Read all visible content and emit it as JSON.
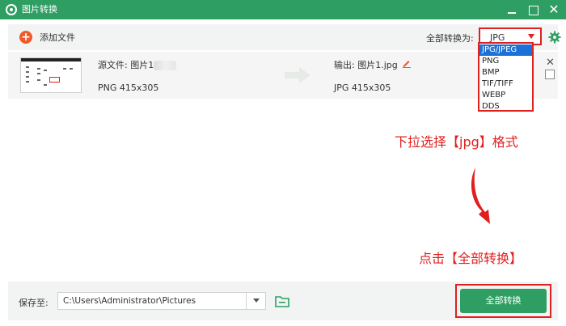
{
  "window": {
    "title": "图片转换",
    "close_glyph": "✕"
  },
  "toolbar": {
    "add_label": "添加文件",
    "convert_to_label": "全部转换为:",
    "format_value": "JPG"
  },
  "dropdown": {
    "options": [
      "JPG/JPEG",
      "PNG",
      "BMP",
      "TIF/TIFF",
      "WEBP",
      "DDS"
    ],
    "selected": "JPG/JPEG"
  },
  "file": {
    "source_label": "源文件: 图片1",
    "source_info": "PNG   415x305",
    "output_label": "输出: 图片1.jpg",
    "output_info": "JPG   415x305",
    "remove_glyph": "✕"
  },
  "annotations": {
    "select_format": "下拉选择【jpg】格式",
    "click_convert": "点击【全部转换】"
  },
  "bottom": {
    "save_label": "保存至:",
    "path": "C:\\Users\\Administrator\\Pictures",
    "convert_all_label": "全部转换"
  },
  "colors": {
    "brand": "#2f9e63",
    "annotation": "#e02020",
    "add": "#f05a28",
    "selected": "#1c71d8"
  },
  "icons": [
    "app-logo-icon",
    "plus-icon",
    "gear-icon",
    "convert-arrow-icon",
    "edit-pencil-icon",
    "folder-icon",
    "chevron-down-icon"
  ]
}
